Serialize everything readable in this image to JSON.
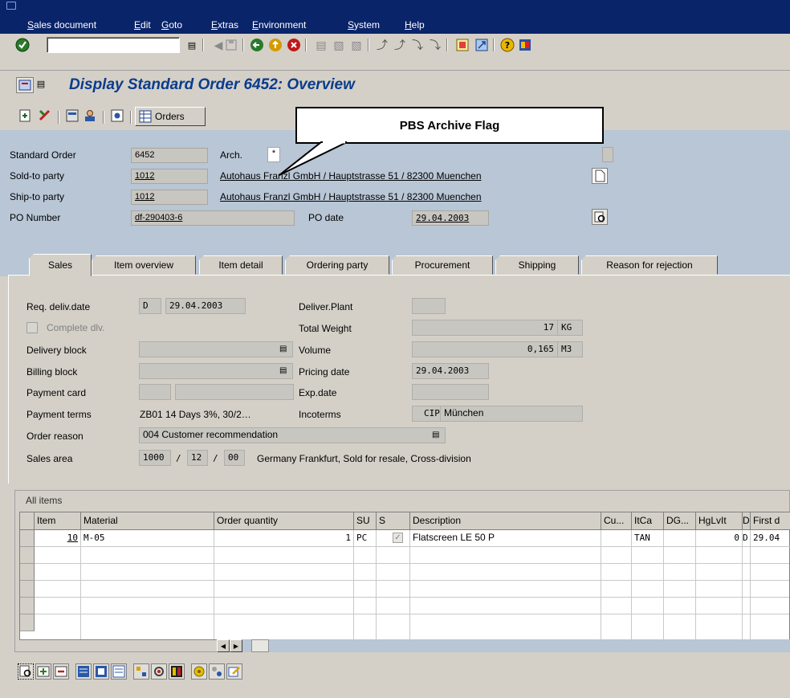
{
  "menu": [
    "Sales document",
    "Edit",
    "Goto",
    "Extras",
    "Environment",
    "System",
    "Help"
  ],
  "title": "Display Standard Order 6452: Overview",
  "app_toolbar": {
    "orders_label": "Orders"
  },
  "callout": "PBS Archive Flag",
  "header": {
    "standard_order_label": "Standard Order",
    "standard_order_value": "6452",
    "arch_label": "Arch.",
    "arch_value": "*",
    "sold_to_label": "Sold-to party",
    "sold_to_value": "1012",
    "sold_to_desc": "Autohaus Franzl GmbH / Hauptstrasse 51 / 82300 Muenchen",
    "ship_to_label": "Ship-to party",
    "ship_to_value": "1012",
    "ship_to_desc": "Autohaus Franzl GmbH / Hauptstrasse 51 / 82300 Muenchen",
    "po_number_label": "PO Number",
    "po_number_value": "df-290403-6",
    "po_date_label": "PO date",
    "po_date_value": "29.04.2003"
  },
  "tabs": [
    "Sales",
    "Item overview",
    "Item detail",
    "Ordering party",
    "Procurement",
    "Shipping",
    "Reason for rejection"
  ],
  "sales": {
    "req_deliv_label": "Req. deliv.date",
    "req_deliv_type": "D",
    "req_deliv_date": "29.04.2003",
    "complete_dlv_label": "Complete dlv.",
    "delivery_block_label": "Delivery block",
    "billing_block_label": "Billing block",
    "payment_card_label": "Payment card",
    "payment_terms_label": "Payment terms",
    "payment_terms_value": "ZB01 14 Days 3%, 30/2…",
    "order_reason_label": "Order reason",
    "order_reason_value": "004 Customer recommendation",
    "sales_area_label": "Sales area",
    "sales_org": "1000",
    "dist_channel": "12",
    "division": "00",
    "sales_area_desc": "Germany Frankfurt, Sold for resale, Cross-division",
    "deliver_plant_label": "Deliver.Plant",
    "total_weight_label": "Total Weight",
    "total_weight_value": "17",
    "total_weight_unit": "KG",
    "volume_label": "Volume",
    "volume_value": "0,165",
    "volume_unit": "M3",
    "pricing_date_label": "Pricing date",
    "pricing_date_value": "29.04.2003",
    "exp_date_label": "Exp.date",
    "incoterms_label": "Incoterms",
    "incoterms_code": "CIP",
    "incoterms_place": "München"
  },
  "items": {
    "title": "All items",
    "columns": [
      "Item",
      "Material",
      "Order quantity",
      "SU",
      "S",
      "Description",
      "Cu...",
      "ItCa",
      "DG...",
      "HgLvIt",
      "D",
      "First d"
    ],
    "row": {
      "item": "10",
      "material": "M-05",
      "qty": "1",
      "su": "PC",
      "desc": "Flatscreen LE 50 P",
      "itca": "TAN",
      "hglvit": "0",
      "d": "D",
      "first": "29.04"
    }
  },
  "icons": [
    "check-icon",
    "save-icon",
    "back-icon",
    "exit-icon",
    "cancel-icon",
    "print-icon",
    "find-icon",
    "help-icon",
    "layout-icon"
  ]
}
